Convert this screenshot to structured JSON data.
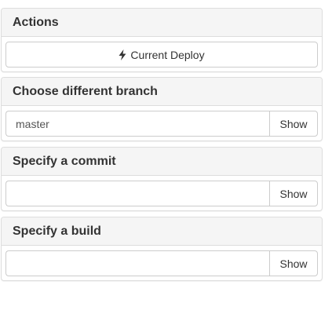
{
  "actions": {
    "title": "Actions",
    "current_deploy_label": "Current Deploy",
    "current_deploy_icon": "lightning-bolt-icon"
  },
  "branch": {
    "title": "Choose different branch",
    "value": "master",
    "placeholder": "",
    "show_label": "Show"
  },
  "commit": {
    "title": "Specify a commit",
    "value": "",
    "placeholder": "",
    "show_label": "Show"
  },
  "build": {
    "title": "Specify a build",
    "value": "",
    "placeholder": "",
    "show_label": "Show"
  }
}
